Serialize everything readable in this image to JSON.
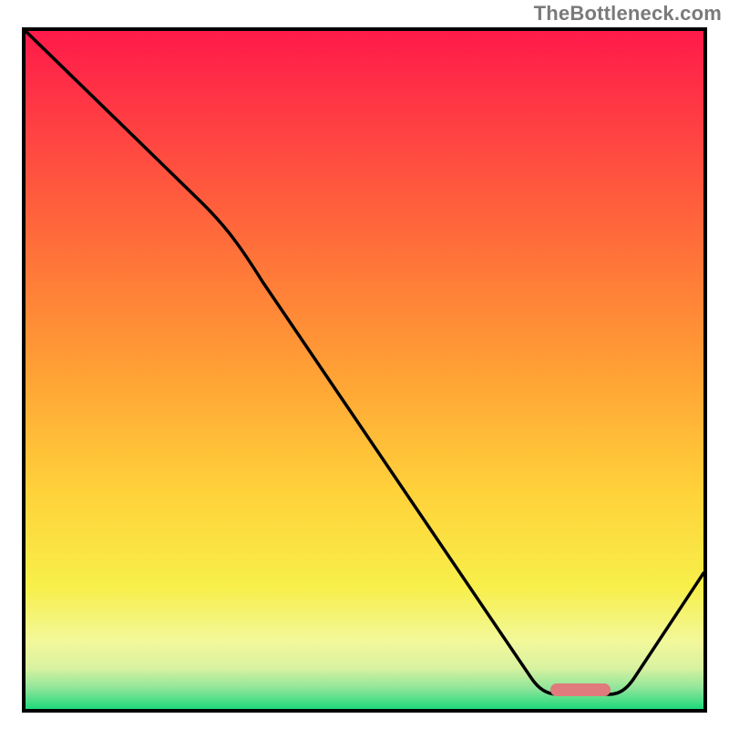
{
  "watermark": "TheBottleneck.com",
  "colors": {
    "gradient_top": "#ff1a4a",
    "gradient_bottom": "#1ed97a",
    "curve": "#000000",
    "frame": "#000000",
    "marker": "#e07a7d",
    "watermark": "#7a7a7a"
  },
  "chart_data": {
    "type": "line",
    "title": "",
    "xlabel": "",
    "ylabel": "",
    "xlim": [
      0,
      100
    ],
    "ylim": [
      0,
      100
    ],
    "grid": false,
    "legend": false,
    "note": "Axes are normalized 0-100 (no tick labels shown). y is read as 100 at top, 0 at bottom.",
    "series": [
      {
        "name": "bottleneck-curve",
        "x": [
          0,
          10,
          20,
          26,
          35,
          50,
          65,
          75,
          80,
          86,
          90,
          100
        ],
        "y": [
          100,
          87,
          74,
          68,
          55,
          32,
          12,
          4,
          2,
          2,
          6,
          20
        ]
      }
    ],
    "marker": {
      "name": "optimal-range",
      "x_start": 77,
      "x_end": 86,
      "y": 2
    },
    "background_gradient_meaning": "red = high bottleneck, green = low bottleneck"
  }
}
